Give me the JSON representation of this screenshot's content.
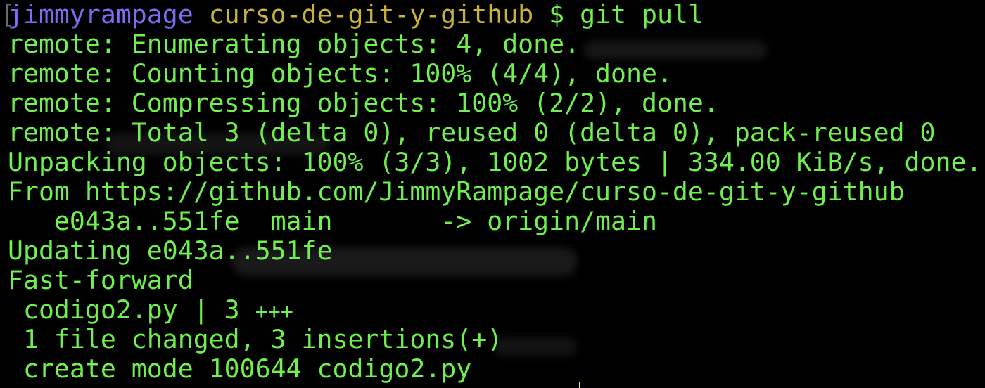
{
  "terminal": {
    "prompt": {
      "user": "jimmyrampage",
      "dir": "curso-de-git-y-github",
      "symbol": "$",
      "command": "git pull"
    },
    "lines": [
      "remote: Enumerating objects: 4, done.",
      "remote: Counting objects: 100% (4/4), done.",
      "remote: Compressing objects: 100% (2/2), done.",
      "remote: Total 3 (delta 0), reused 0 (delta 0), pack-reused 0",
      "Unpacking objects: 100% (3/3), 1002 bytes | 334.00 KiB/s, done.",
      "From https://github.com/JimmyRampage/curso-de-git-y-github",
      "   e043a..551fe  main       -> origin/main",
      "Updating e043a..551fe",
      "Fast-forward",
      " codigo2.py | 3 ",
      " 1 file changed, 3 insertions(+)",
      " create mode 100644 codigo2.py"
    ],
    "diffstat_plus": "+++",
    "colors": {
      "background": "#000000",
      "text": "#6ff04f",
      "user": "#7b6cf2",
      "dir": "#c8b43a"
    }
  }
}
